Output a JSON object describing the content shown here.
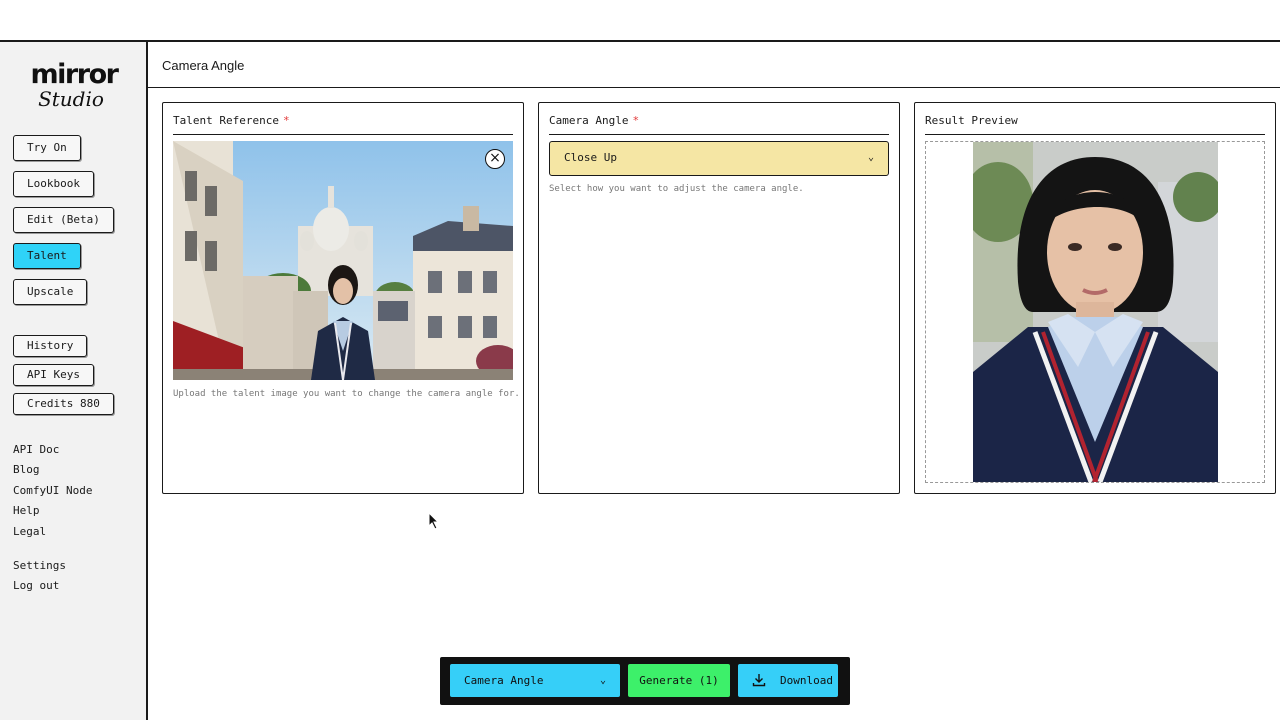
{
  "header": {
    "title": "Camera Angle"
  },
  "logo": {
    "line1": "mirror",
    "line2": "Studio"
  },
  "sidebar": {
    "primary": [
      {
        "label": "Try On",
        "active": false
      },
      {
        "label": "Lookbook",
        "active": false
      },
      {
        "label": "Edit (Beta)",
        "active": false
      },
      {
        "label": "Talent",
        "active": true
      },
      {
        "label": "Upscale",
        "active": false
      }
    ],
    "secondary": [
      {
        "label": "History"
      },
      {
        "label": "API Keys"
      },
      {
        "label": "Credits 880"
      }
    ],
    "links": [
      "API Doc",
      "Blog",
      "ComfyUI Node",
      "Help",
      "Legal"
    ],
    "footer_links": [
      "Settings",
      "Log out"
    ]
  },
  "panels": {
    "talent": {
      "title": "Talent Reference",
      "required_mark": "*",
      "helper": "Upload the talent image you want to change the camera angle for."
    },
    "camera": {
      "title": "Camera Angle",
      "required_mark": "*",
      "selected": "Close Up",
      "helper": "Select how you want to adjust the camera angle."
    },
    "result": {
      "title": "Result Preview"
    }
  },
  "toolbar": {
    "mode": "Camera Angle",
    "generate": "Generate (1)",
    "download": "Download"
  },
  "colors": {
    "accent": "#2fd3f8",
    "generate": "#3df06a",
    "select_bg": "#f5e6a4",
    "required": "#e23a3a"
  },
  "icons": [
    "close-icon",
    "chevron-down-icon",
    "download-icon",
    "cursor-icon"
  ]
}
